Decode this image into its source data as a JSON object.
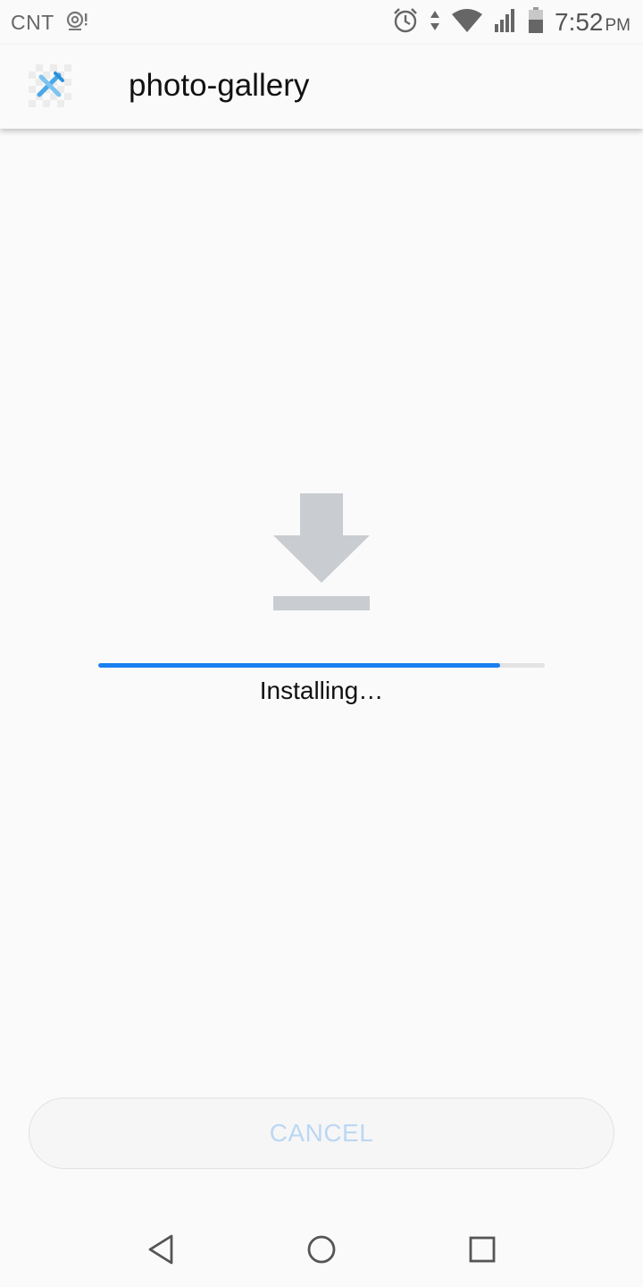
{
  "status_bar": {
    "carrier": "CNT",
    "time": "7:52",
    "ampm": "PM",
    "icons": [
      "hotspot-icon",
      "alarm-icon",
      "data-transfer-icon",
      "wifi-icon",
      "signal-icon",
      "battery-icon"
    ]
  },
  "app_bar": {
    "title": "photo-gallery",
    "icon": "app-icon"
  },
  "main": {
    "graphic_icon": "download-icon",
    "progress_fraction": 0.9,
    "status_text": "Installing…"
  },
  "cancel_button": {
    "label": "CANCEL",
    "enabled": false
  },
  "nav_bar": {
    "buttons": [
      "back-icon",
      "home-icon",
      "recents-icon"
    ]
  },
  "colors": {
    "accent": "#1a7ff0",
    "background": "#fafafa",
    "disabled_text": "#bcd7f3"
  }
}
